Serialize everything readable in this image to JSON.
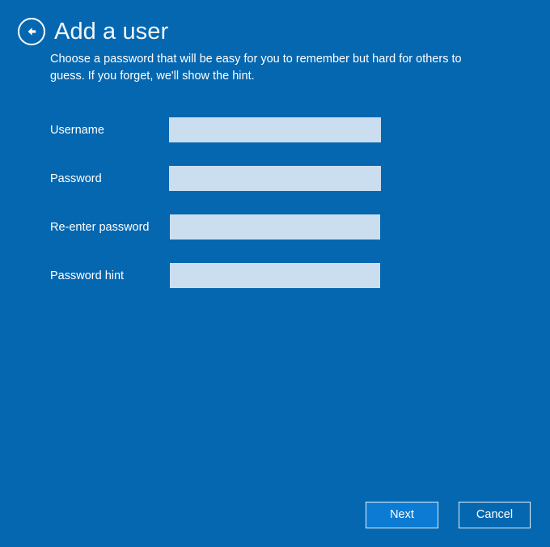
{
  "window": {
    "background_color": "#0567b0",
    "accent_color": "#0c7bd4",
    "field_fill_color": "#cbdeef"
  },
  "header": {
    "back_icon": "back-arrow-circle-icon",
    "title": "Add a user",
    "description": "Choose a password that will be easy for you to remember but hard for others to guess. If you forget, we'll show the hint."
  },
  "form": {
    "fields": [
      {
        "label": "Username",
        "value": "",
        "placeholder": "",
        "type": "text",
        "name": "username"
      },
      {
        "label": "Password",
        "value": "",
        "placeholder": "",
        "type": "password",
        "name": "password"
      },
      {
        "label": "Re-enter password",
        "value": "",
        "placeholder": "",
        "type": "password",
        "name": "reenter-password"
      },
      {
        "label": "Password hint",
        "value": "",
        "placeholder": "",
        "type": "text",
        "name": "password-hint"
      }
    ]
  },
  "footer": {
    "next_label": "Next",
    "cancel_label": "Cancel"
  }
}
